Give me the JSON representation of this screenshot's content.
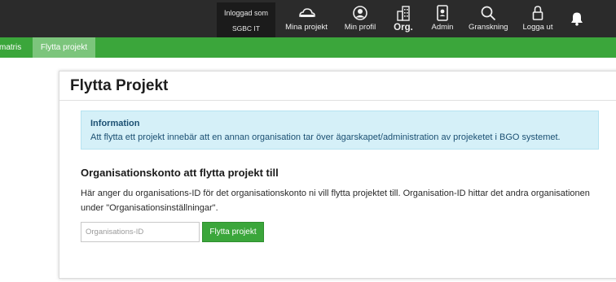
{
  "header": {
    "login_line1": "Inloggad som",
    "login_line2": "SGBC IT",
    "nav": [
      {
        "label": "Mina projekt",
        "icon": "cloud-icon"
      },
      {
        "label": "Min profil",
        "icon": "user-circle-icon"
      },
      {
        "label": "Org.",
        "icon": "building-icon"
      },
      {
        "label": "Admin",
        "icon": "id-badge-icon"
      },
      {
        "label": "Granskning",
        "icon": "search-icon"
      },
      {
        "label": "Logga ut",
        "icon": "lock-icon"
      }
    ],
    "notifications_icon": "bell-icon"
  },
  "subnav": {
    "items": [
      {
        "label": "matris"
      },
      {
        "label": "Flytta projekt",
        "active": true
      }
    ]
  },
  "main": {
    "title": "Flytta Projekt",
    "info": {
      "title": "Information",
      "text": "Att flytta ett projekt innebär att en annan organisation tar över ägarskapet/administration av projeketet i BGO systemet."
    },
    "section_title": "Organisationskonto att flytta projekt till",
    "description": "Här anger du organisations-ID för det organisationskonto ni vill flytta projektet till. Organisation-ID hittar det andra organisationen under \"Organisationsinställningar\".",
    "org_id_placeholder": "Organisations-ID",
    "org_id_value": "",
    "move_button_label": "Flytta projekt"
  },
  "colors": {
    "topbar": "#2b2b2b",
    "green": "#3ba63b",
    "green_active": "#7cc57c",
    "info_bg": "#d5f0f8",
    "info_text": "#1b4f72"
  }
}
